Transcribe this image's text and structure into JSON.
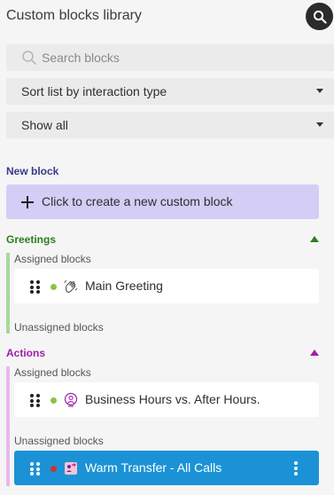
{
  "header": {
    "title": "Custom blocks library",
    "search_icon": "search-icon"
  },
  "search": {
    "placeholder": "Search blocks",
    "value": ""
  },
  "filters": {
    "sort": "Sort list by interaction type",
    "show": "Show all"
  },
  "new_block": {
    "section_label": "New block",
    "button_label": "Click to create a new custom block"
  },
  "groups": [
    {
      "label": "Greetings",
      "color": "#2e7d1f",
      "bar_color": "#a5d99a",
      "assigned_label": "Assigned blocks",
      "unassigned_label": "Unassigned blocks",
      "assigned": [
        {
          "name": "Main Greeting",
          "status_color": "#8bc34a",
          "icon": "hand-wave-icon"
        }
      ],
      "unassigned": []
    },
    {
      "label": "Actions",
      "color": "#a020a8",
      "bar_color": "#e8b8ec",
      "assigned_label": "Assigned blocks",
      "unassigned_label": "Unassigned blocks",
      "assigned": [
        {
          "name": "Business Hours vs. After Hours.",
          "status_color": "#8bc34a",
          "icon": "clock-person-icon"
        }
      ],
      "unassigned": [
        {
          "name": "Warm Transfer - All Calls",
          "status_color": "#d32f2f",
          "icon": "transfer-icon"
        }
      ]
    }
  ],
  "colors": {
    "accent": "#1b92d6",
    "new_block_bg": "#d4cdf6",
    "new_block_label": "#3a3a8a"
  }
}
